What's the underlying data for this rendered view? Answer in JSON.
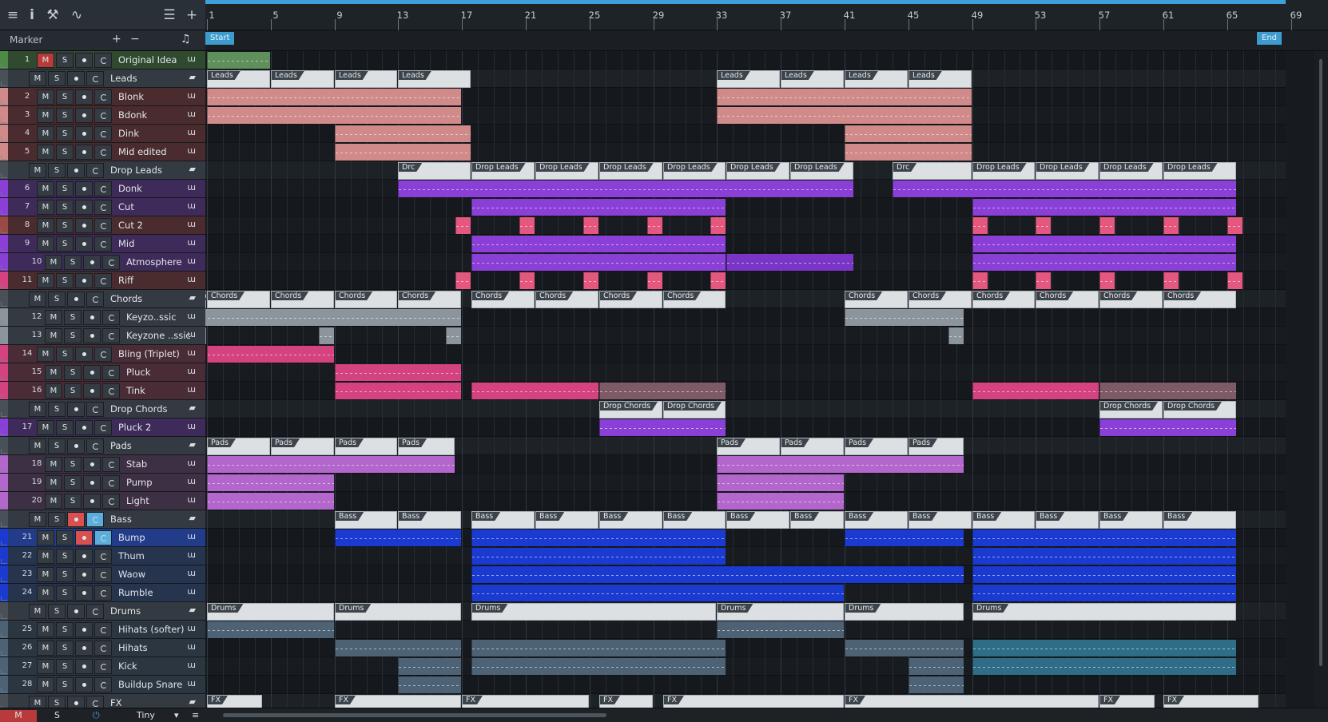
{
  "toolbar": {
    "icons": [
      "menu-icon",
      "info-icon",
      "wrench-icon",
      "automation-icon",
      "list-icon",
      "add-icon"
    ]
  },
  "marker_header": {
    "label": "Marker",
    "add": "+",
    "remove": "−",
    "icon": "♫"
  },
  "status": {
    "m": "M",
    "s": "S",
    "power": "⏻",
    "size": "Tiny",
    "menu": "▾"
  },
  "ruler": {
    "bars": [
      "1",
      "5",
      "9",
      "13",
      "17",
      "21",
      "25",
      "29",
      "33",
      "37",
      "41",
      "45",
      "49",
      "53",
      "57",
      "61",
      "65",
      "69"
    ]
  },
  "markers": {
    "start": "Start",
    "end": "End"
  },
  "btn": {
    "m": "M",
    "s": "S"
  },
  "colors": {
    "accent": "#3f9fda",
    "green": "#4c8a45",
    "salmon": "#d08a8a",
    "purple": "#8a3fd6",
    "pink": "#d4427f",
    "gray": "#8c959c",
    "lilac": "#b366cc",
    "blue": "#1a3ad0",
    "slate": "#4d6275",
    "rust": "#9a4a45"
  },
  "tracks": [
    {
      "num": "1",
      "name": "Original Idea",
      "type": "track",
      "color": "#4c8a45",
      "bg": "#2f4a2f"
    },
    {
      "num": "",
      "name": "Leads",
      "type": "folder",
      "color": "#3b4148",
      "bg": "#343a41"
    },
    {
      "num": "2",
      "name": "Blonk",
      "type": "track",
      "color": "#d08a8a",
      "bg": "#4a2c2e"
    },
    {
      "num": "3",
      "name": "Bdonk",
      "type": "track",
      "color": "#d08a8a",
      "bg": "#4a2c2e"
    },
    {
      "num": "4",
      "name": "Dink",
      "type": "track",
      "color": "#d08a8a",
      "bg": "#4a2c2e"
    },
    {
      "num": "5",
      "name": "Mid edited",
      "type": "track",
      "color": "#d08a8a",
      "bg": "#4a2c2e"
    },
    {
      "num": "",
      "name": "Drop Leads",
      "type": "folder",
      "color": "#3b4148",
      "bg": "#343a41"
    },
    {
      "num": "6",
      "name": "Donk",
      "type": "track",
      "color": "#8a3fd6",
      "bg": "#3e2b5a"
    },
    {
      "num": "7",
      "name": "Cut",
      "type": "track",
      "color": "#8a3fd6",
      "bg": "#3e2b5a"
    },
    {
      "num": "8",
      "name": "Cut 2",
      "type": "track",
      "color": "#9a4a45",
      "bg": "#4a2c2e"
    },
    {
      "num": "9",
      "name": "Mid",
      "type": "track",
      "color": "#8a3fd6",
      "bg": "#3e2b5a"
    },
    {
      "num": "10",
      "name": "Atmosphere",
      "type": "track",
      "color": "#8a3fd6",
      "bg": "#3e2b5a"
    },
    {
      "num": "11",
      "name": "Riff",
      "type": "track",
      "color": "#d4427f",
      "bg": "#4a2c2e"
    },
    {
      "num": "",
      "name": "Chords",
      "type": "folder",
      "color": "#3b4148",
      "bg": "#343a41"
    },
    {
      "num": "12",
      "name": "Keyzo..ssic",
      "type": "track",
      "color": "#8c959c",
      "bg": "#343a41"
    },
    {
      "num": "13",
      "name": "Keyzone ..ssic",
      "type": "track",
      "color": "#8c959c",
      "bg": "#343a41"
    },
    {
      "num": "14",
      "name": "Bling (Triplet)",
      "type": "track",
      "color": "#d4427f",
      "bg": "#4a2c36"
    },
    {
      "num": "15",
      "name": "Pluck",
      "type": "track",
      "color": "#d4427f",
      "bg": "#4a2c36"
    },
    {
      "num": "16",
      "name": "Tink",
      "type": "track",
      "color": "#d4427f",
      "bg": "#4a2c36"
    },
    {
      "num": "",
      "name": "Drop Chords",
      "type": "folder",
      "color": "#3b4148",
      "bg": "#343a41"
    },
    {
      "num": "17",
      "name": "Pluck 2",
      "type": "track",
      "color": "#8a3fd6",
      "bg": "#3e2b5a"
    },
    {
      "num": "",
      "name": "Pads",
      "type": "folder",
      "color": "#3b4148",
      "bg": "#343a41"
    },
    {
      "num": "18",
      "name": "Stab",
      "type": "track",
      "color": "#b366cc",
      "bg": "#3e3044"
    },
    {
      "num": "19",
      "name": "Pump",
      "type": "track",
      "color": "#b366cc",
      "bg": "#3e3044"
    },
    {
      "num": "20",
      "name": "Light",
      "type": "track",
      "color": "#b366cc",
      "bg": "#3e3044"
    },
    {
      "num": "",
      "name": "Bass",
      "type": "folder",
      "color": "#3b4148",
      "bg": "#343a41"
    },
    {
      "num": "21",
      "name": "Bump",
      "type": "track",
      "color": "#1a3ad0",
      "bg": "#223c8a"
    },
    {
      "num": "22",
      "name": "Thum",
      "type": "track",
      "color": "#1a3ad0",
      "bg": "#26344e"
    },
    {
      "num": "23",
      "name": "Waow",
      "type": "track",
      "color": "#1a3ad0",
      "bg": "#26344e"
    },
    {
      "num": "24",
      "name": "Rumble",
      "type": "track",
      "color": "#1a3ad0",
      "bg": "#26344e"
    },
    {
      "num": "",
      "name": "Drums",
      "type": "folder",
      "color": "#3b4148",
      "bg": "#343a41"
    },
    {
      "num": "25",
      "name": "Hihats (softer)",
      "type": "track",
      "color": "#4d6275",
      "bg": "#2b3640"
    },
    {
      "num": "26",
      "name": "Hihats",
      "type": "track",
      "color": "#4d6275",
      "bg": "#2b3640"
    },
    {
      "num": "27",
      "name": "Kick",
      "type": "track",
      "color": "#4d6275",
      "bg": "#2b3640"
    },
    {
      "num": "28",
      "name": "Buildup Snare",
      "type": "track",
      "color": "#4d6275",
      "bg": "#2b3640"
    },
    {
      "num": "",
      "name": "FX",
      "type": "folder",
      "color": "#3b4148",
      "bg": "#343a41"
    }
  ],
  "clips": [
    {
      "row": 0,
      "b": 1,
      "e": 5,
      "c": "#5f8f5a"
    },
    {
      "row": 1,
      "b": 1,
      "e": 5,
      "f": "Leads"
    },
    {
      "row": 1,
      "b": 5,
      "e": 9,
      "f": "Leads"
    },
    {
      "row": 1,
      "b": 9,
      "e": 13,
      "f": "Leads"
    },
    {
      "row": 1,
      "b": 13,
      "e": 17.6,
      "f": "Leads"
    },
    {
      "row": 1,
      "b": 33,
      "e": 37,
      "f": "Leads"
    },
    {
      "row": 1,
      "b": 37,
      "e": 41,
      "f": "Leads"
    },
    {
      "row": 1,
      "b": 41,
      "e": 45,
      "f": "Leads"
    },
    {
      "row": 1,
      "b": 45,
      "e": 49,
      "f": "Leads"
    },
    {
      "row": 2,
      "b": 1,
      "e": 17,
      "c": "#d08a8a"
    },
    {
      "row": 3,
      "b": 1,
      "e": 17,
      "c": "#d08a8a"
    },
    {
      "row": 4,
      "b": 9,
      "e": 17.6,
      "c": "#d08a8a"
    },
    {
      "row": 5,
      "b": 9,
      "e": 17.6,
      "c": "#d08a8a"
    },
    {
      "row": 2,
      "b": 33,
      "e": 49,
      "c": "#d08a8a"
    },
    {
      "row": 3,
      "b": 33,
      "e": 49,
      "c": "#d08a8a"
    },
    {
      "row": 4,
      "b": 41,
      "e": 49,
      "c": "#d08a8a"
    },
    {
      "row": 5,
      "b": 41,
      "e": 49,
      "c": "#d08a8a"
    },
    {
      "row": 6,
      "b": 13,
      "e": 17.6,
      "f": "Drc"
    },
    {
      "row": 6,
      "b": 17.6,
      "e": 21.6,
      "f": "Drop Leads"
    },
    {
      "row": 6,
      "b": 21.6,
      "e": 25.6,
      "f": "Drop Leads"
    },
    {
      "row": 6,
      "b": 25.6,
      "e": 29.6,
      "f": "Drop Leads"
    },
    {
      "row": 6,
      "b": 29.6,
      "e": 33.6,
      "f": "Drop Leads"
    },
    {
      "row": 6,
      "b": 33.6,
      "e": 37.6,
      "f": "Drop Leads"
    },
    {
      "row": 6,
      "b": 37.6,
      "e": 41.6,
      "f": "Drop Leads"
    },
    {
      "row": 6,
      "b": 44,
      "e": 49,
      "f": "Drc"
    },
    {
      "row": 6,
      "b": 49,
      "e": 53,
      "f": "Drop Leads"
    },
    {
      "row": 6,
      "b": 53,
      "e": 57,
      "f": "Drop Leads"
    },
    {
      "row": 6,
      "b": 57,
      "e": 61,
      "f": "Drop Leads"
    },
    {
      "row": 6,
      "b": 61,
      "e": 65.6,
      "f": "Drop Leads"
    },
    {
      "row": 7,
      "b": 13,
      "e": 41.6,
      "c": "#8a3fd6"
    },
    {
      "row": 7,
      "b": 44,
      "e": 65.6,
      "c": "#8a3fd6"
    },
    {
      "row": 8,
      "b": 17.6,
      "e": 33.6,
      "c": "#8a3fd6"
    },
    {
      "row": 8,
      "b": 49,
      "e": 65.6,
      "c": "#8a3fd6"
    },
    {
      "row": 9,
      "b": 16.6,
      "e": 17.6,
      "c": "#e4587f"
    },
    {
      "row": 9,
      "b": 20.6,
      "e": 21.6,
      "c": "#e4587f"
    },
    {
      "row": 9,
      "b": 24.6,
      "e": 25.6,
      "c": "#e4587f"
    },
    {
      "row": 9,
      "b": 28.6,
      "e": 29.6,
      "c": "#e4587f"
    },
    {
      "row": 9,
      "b": 32.6,
      "e": 33.6,
      "c": "#e4587f"
    },
    {
      "row": 9,
      "b": 49,
      "e": 50,
      "c": "#e4587f"
    },
    {
      "row": 9,
      "b": 53,
      "e": 54,
      "c": "#e4587f"
    },
    {
      "row": 9,
      "b": 57,
      "e": 58,
      "c": "#e4587f"
    },
    {
      "row": 9,
      "b": 61,
      "e": 62,
      "c": "#e4587f"
    },
    {
      "row": 9,
      "b": 65,
      "e": 66,
      "c": "#e4587f"
    },
    {
      "row": 10,
      "b": 17.6,
      "e": 33.6,
      "c": "#8a3fd6"
    },
    {
      "row": 10,
      "b": 49,
      "e": 65.6,
      "c": "#8a3fd6"
    },
    {
      "row": 11,
      "b": 17.6,
      "e": 33.6,
      "c": "#8a3fd6"
    },
    {
      "row": 11,
      "b": 33.6,
      "e": 41.6,
      "c": "#7a35c6"
    },
    {
      "row": 11,
      "b": 49,
      "e": 65.6,
      "c": "#8a3fd6"
    },
    {
      "row": 12,
      "b": 16.6,
      "e": 17.6,
      "c": "#e4587f"
    },
    {
      "row": 12,
      "b": 20.6,
      "e": 21.6,
      "c": "#e4587f"
    },
    {
      "row": 12,
      "b": 24.6,
      "e": 25.6,
      "c": "#e4587f"
    },
    {
      "row": 12,
      "b": 28.6,
      "e": 29.6,
      "c": "#e4587f"
    },
    {
      "row": 12,
      "b": 32.6,
      "e": 33.6,
      "c": "#e4587f"
    },
    {
      "row": 12,
      "b": 49,
      "e": 50,
      "c": "#e4587f"
    },
    {
      "row": 12,
      "b": 53,
      "e": 54,
      "c": "#e4587f"
    },
    {
      "row": 12,
      "b": 57,
      "e": 58,
      "c": "#e4587f"
    },
    {
      "row": 12,
      "b": 61,
      "e": 62,
      "c": "#e4587f"
    },
    {
      "row": 12,
      "b": 65,
      "e": 66,
      "c": "#e4587f"
    },
    {
      "row": 13,
      "b": 0.1,
      "e": 1,
      "f": "Ch"
    },
    {
      "row": 13,
      "b": 1,
      "e": 5,
      "f": "Chords"
    },
    {
      "row": 13,
      "b": 5,
      "e": 9,
      "f": "Chords"
    },
    {
      "row": 13,
      "b": 9,
      "e": 13,
      "f": "Chords"
    },
    {
      "row": 13,
      "b": 13,
      "e": 17,
      "f": "Chords"
    },
    {
      "row": 13,
      "b": 17.6,
      "e": 21.6,
      "f": "Chords"
    },
    {
      "row": 13,
      "b": 21.6,
      "e": 25.6,
      "f": "Chords"
    },
    {
      "row": 13,
      "b": 25.6,
      "e": 29.6,
      "f": "Chords"
    },
    {
      "row": 13,
      "b": 29.6,
      "e": 33.6,
      "f": "Chords"
    },
    {
      "row": 13,
      "b": 41,
      "e": 45,
      "f": "Chords"
    },
    {
      "row": 13,
      "b": 45,
      "e": 49,
      "f": "Chords"
    },
    {
      "row": 13,
      "b": 49,
      "e": 53,
      "f": "Chords"
    },
    {
      "row": 13,
      "b": 53,
      "e": 57,
      "f": "Chords"
    },
    {
      "row": 13,
      "b": 57,
      "e": 61,
      "f": "Chords"
    },
    {
      "row": 13,
      "b": 61,
      "e": 65.6,
      "f": "Chords"
    },
    {
      "row": 14,
      "b": 0.1,
      "e": 17,
      "c": "#8c959c"
    },
    {
      "row": 14,
      "b": 41,
      "e": 48.5,
      "c": "#8c959c"
    },
    {
      "row": 15,
      "b": 0.1,
      "e": 1,
      "c": "#8c959c"
    },
    {
      "row": 15,
      "b": 8,
      "e": 9,
      "c": "#8c959c"
    },
    {
      "row": 15,
      "b": 16,
      "e": 17,
      "c": "#8c959c"
    },
    {
      "row": 15,
      "b": 47.5,
      "e": 48.5,
      "c": "#8c959c"
    },
    {
      "row": 16,
      "b": 1,
      "e": 9,
      "c": "#d4427f"
    },
    {
      "row": 17,
      "b": 9,
      "e": 17,
      "c": "#d4427f"
    },
    {
      "row": 18,
      "b": 9,
      "e": 17,
      "c": "#d4427f"
    },
    {
      "row": 18,
      "b": 17.6,
      "e": 25.6,
      "c": "#d4427f"
    },
    {
      "row": 18,
      "b": 25.6,
      "e": 33.6,
      "c": "#7e5a66"
    },
    {
      "row": 18,
      "b": 49,
      "e": 57,
      "c": "#d4427f"
    },
    {
      "row": 18,
      "b": 57,
      "e": 65.6,
      "c": "#7e5a66"
    },
    {
      "row": 19,
      "b": 25.6,
      "e": 29.6,
      "f": "Drop Chords"
    },
    {
      "row": 19,
      "b": 29.6,
      "e": 33.6,
      "f": "Drop Chords"
    },
    {
      "row": 19,
      "b": 57,
      "e": 61,
      "f": "Drop Chords"
    },
    {
      "row": 19,
      "b": 61,
      "e": 65.6,
      "f": "Drop Chords"
    },
    {
      "row": 20,
      "b": 25.6,
      "e": 33.6,
      "c": "#8a3fd6"
    },
    {
      "row": 20,
      "b": 57,
      "e": 65.6,
      "c": "#8a3fd6"
    },
    {
      "row": 21,
      "b": 1,
      "e": 5,
      "f": "Pads"
    },
    {
      "row": 21,
      "b": 5,
      "e": 9,
      "f": "Pads"
    },
    {
      "row": 21,
      "b": 9,
      "e": 13,
      "f": "Pads"
    },
    {
      "row": 21,
      "b": 13,
      "e": 16.6,
      "f": "Pads"
    },
    {
      "row": 21,
      "b": 33,
      "e": 37,
      "f": "Pads"
    },
    {
      "row": 21,
      "b": 37,
      "e": 41,
      "f": "Pads"
    },
    {
      "row": 21,
      "b": 41,
      "e": 45,
      "f": "Pads"
    },
    {
      "row": 21,
      "b": 45,
      "e": 48.5,
      "f": "Pads"
    },
    {
      "row": 22,
      "b": 1,
      "e": 16.6,
      "c": "#b366cc"
    },
    {
      "row": 22,
      "b": 33,
      "e": 48.5,
      "c": "#b366cc"
    },
    {
      "row": 23,
      "b": 1,
      "e": 9,
      "c": "#b366cc"
    },
    {
      "row": 23,
      "b": 33,
      "e": 41,
      "c": "#b366cc"
    },
    {
      "row": 24,
      "b": 1,
      "e": 9,
      "c": "#b366cc"
    },
    {
      "row": 24,
      "b": 33,
      "e": 41,
      "c": "#b366cc"
    },
    {
      "row": 25,
      "b": 9,
      "e": 13,
      "f": "Bass"
    },
    {
      "row": 25,
      "b": 13,
      "e": 17,
      "f": "Bass"
    },
    {
      "row": 25,
      "b": 17.6,
      "e": 21.6,
      "f": "Bass"
    },
    {
      "row": 25,
      "b": 21.6,
      "e": 25.6,
      "f": "Bass"
    },
    {
      "row": 25,
      "b": 25.6,
      "e": 29.6,
      "f": "Bass"
    },
    {
      "row": 25,
      "b": 29.6,
      "e": 33.6,
      "f": "Bass"
    },
    {
      "row": 25,
      "b": 33.6,
      "e": 37.6,
      "f": "Bass"
    },
    {
      "row": 25,
      "b": 37.6,
      "e": 41,
      "f": "Bass"
    },
    {
      "row": 25,
      "b": 41,
      "e": 45,
      "f": "Bass"
    },
    {
      "row": 25,
      "b": 45,
      "e": 49,
      "f": "Bass"
    },
    {
      "row": 25,
      "b": 49,
      "e": 53,
      "f": "Bass"
    },
    {
      "row": 25,
      "b": 53,
      "e": 57,
      "f": "Bass"
    },
    {
      "row": 25,
      "b": 57,
      "e": 61,
      "f": "Bass"
    },
    {
      "row": 25,
      "b": 61,
      "e": 65.6,
      "f": "Bass"
    },
    {
      "row": 26,
      "b": 9,
      "e": 17,
      "c": "#1a3ad0"
    },
    {
      "row": 26,
      "b": 17.6,
      "e": 33.6,
      "c": "#1a3ad0"
    },
    {
      "row": 26,
      "b": 41,
      "e": 48.5,
      "c": "#1a3ad0"
    },
    {
      "row": 26,
      "b": 49,
      "e": 65.6,
      "c": "#1a3ad0"
    },
    {
      "row": 27,
      "b": 17.6,
      "e": 33.6,
      "c": "#1a3ad0"
    },
    {
      "row": 27,
      "b": 49,
      "e": 65.6,
      "c": "#1a3ad0"
    },
    {
      "row": 28,
      "b": 17.6,
      "e": 48.5,
      "c": "#1a3ad0"
    },
    {
      "row": 28,
      "b": 49,
      "e": 65.6,
      "c": "#1a3ad0"
    },
    {
      "row": 29,
      "b": 17.6,
      "e": 41,
      "c": "#1a3ad0"
    },
    {
      "row": 29,
      "b": 49,
      "e": 65.6,
      "c": "#1a3ad0"
    },
    {
      "row": 30,
      "b": 1,
      "e": 9,
      "f": "Drums"
    },
    {
      "row": 30,
      "b": 9,
      "e": 17,
      "f": "Drums"
    },
    {
      "row": 30,
      "b": 17.6,
      "e": 33,
      "f": "Drums"
    },
    {
      "row": 30,
      "b": 33,
      "e": 41,
      "f": "Drums"
    },
    {
      "row": 30,
      "b": 41,
      "e": 48.5,
      "f": "Drums"
    },
    {
      "row": 30,
      "b": 49,
      "e": 65.6,
      "f": "Drums"
    },
    {
      "row": 31,
      "b": 1,
      "e": 9,
      "c": "#4d6275"
    },
    {
      "row": 31,
      "b": 33,
      "e": 41,
      "c": "#4d6275"
    },
    {
      "row": 32,
      "b": 9,
      "e": 17,
      "c": "#4d6275"
    },
    {
      "row": 32,
      "b": 17.6,
      "e": 33.6,
      "c": "#4d6275"
    },
    {
      "row": 32,
      "b": 41,
      "e": 48.5,
      "c": "#4d6275"
    },
    {
      "row": 32,
      "b": 49,
      "e": 65.6,
      "c": "#2f6d86"
    },
    {
      "row": 33,
      "b": 13,
      "e": 17,
      "c": "#4d6275"
    },
    {
      "row": 33,
      "b": 17.6,
      "e": 33.6,
      "c": "#4d6275"
    },
    {
      "row": 33,
      "b": 45,
      "e": 48.5,
      "c": "#4d6275"
    },
    {
      "row": 33,
      "b": 49,
      "e": 65.6,
      "c": "#2f6d86"
    },
    {
      "row": 34,
      "b": 13,
      "e": 17,
      "c": "#4d6275"
    },
    {
      "row": 34,
      "b": 45,
      "e": 48.5,
      "c": "#4d6275"
    },
    {
      "row": 35,
      "b": 1,
      "e": 4.5,
      "f": "FX"
    },
    {
      "row": 35,
      "b": 9,
      "e": 17,
      "f": "FX"
    },
    {
      "row": 35,
      "b": 17,
      "e": 25,
      "f": "FX"
    },
    {
      "row": 35,
      "b": 25.6,
      "e": 29,
      "f": "FX"
    },
    {
      "row": 35,
      "b": 29.6,
      "e": 41,
      "f": "FX"
    },
    {
      "row": 35,
      "b": 41,
      "e": 57,
      "f": "FX"
    },
    {
      "row": 35,
      "b": 57,
      "e": 60.5,
      "f": "FX"
    },
    {
      "row": 35,
      "b": 61,
      "e": 67,
      "f": "FX"
    }
  ]
}
